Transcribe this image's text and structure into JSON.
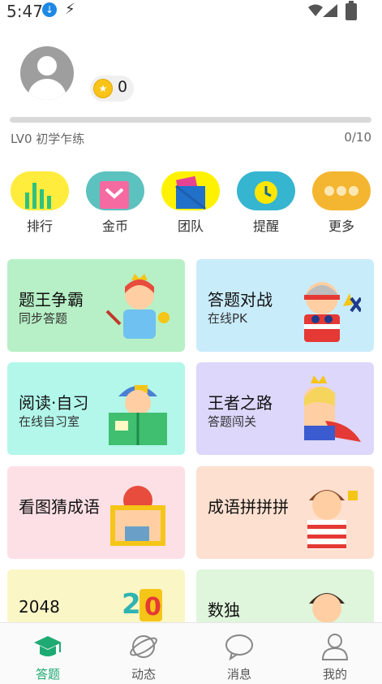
{
  "status_bar": {
    "time": "5:47"
  },
  "profile": {
    "coins": "0",
    "level_label": "LV0 初学乍练",
    "xp_text": "0/10",
    "xp_progress_fraction": 0.0
  },
  "menu": [
    {
      "label": "排行",
      "icon": "chart-icon",
      "color": "#ffec3d"
    },
    {
      "label": "金币",
      "icon": "envelope-icon",
      "color": "#5cc2bf"
    },
    {
      "label": "团队",
      "icon": "book-icon",
      "color": "#fff200"
    },
    {
      "label": "提醒",
      "icon": "clock-icon",
      "color": "#35b5d0"
    },
    {
      "label": "更多",
      "icon": "more-icon",
      "color": "#f4b630"
    }
  ],
  "cards": [
    {
      "title": "题王争霸",
      "subtitle": "同步答题",
      "color": "#b7f0c6"
    },
    {
      "title": "答题对战",
      "subtitle": "在线PK",
      "color": "#c9ecfb"
    },
    {
      "title": "阅读·自习",
      "subtitle": "在线自习室",
      "color": "#b2f7ea"
    },
    {
      "title": "王者之路",
      "subtitle": "答题闯关",
      "color": "#dcd7fb"
    },
    {
      "title": "看图猜成语",
      "subtitle": "",
      "color": "#fde0e6"
    },
    {
      "title": "成语拼拼拼",
      "subtitle": "",
      "color": "#fde0d0"
    },
    {
      "title": "2048",
      "subtitle": "",
      "color": "#fbf6c6"
    },
    {
      "title": "数独",
      "subtitle": "",
      "color": "#dff5dc"
    }
  ],
  "bottom_nav": [
    {
      "label": "答题",
      "icon": "graduation-cap-icon",
      "active": true
    },
    {
      "label": "动态",
      "icon": "planet-icon",
      "active": false
    },
    {
      "label": "消息",
      "icon": "chat-bubble-icon",
      "active": false
    },
    {
      "label": "我的",
      "icon": "person-icon",
      "active": false
    }
  ],
  "colors": {
    "accent": "#1faa73",
    "xp_track": "#d9d9d9"
  }
}
